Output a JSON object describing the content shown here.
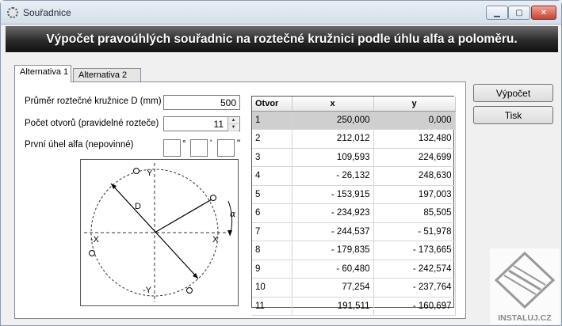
{
  "window": {
    "title": "Souřadnice",
    "minimize": "▁",
    "maximize": "▢",
    "close": "✕"
  },
  "banner": {
    "text": "Výpočet pravoúhlých souřadnic na roztečné kružnici podle úhlu alfa a poloměru."
  },
  "tabs": [
    {
      "label": "Alternativa 1",
      "active": true
    },
    {
      "label": "Alternativa 2",
      "active": false
    }
  ],
  "form": {
    "diameter_label": "Průměr roztečné kružnice D (mm)",
    "diameter_value": "500",
    "holes_label": "Počet otvorů (pravidelné rozteče)",
    "holes_value": "11",
    "angle_label": "První úhel alfa (nepovinné)",
    "deg_symbol": "°",
    "min_symbol": "'",
    "sec_symbol": "\""
  },
  "diagram": {
    "label_y_top": "Y",
    "label_y_bottom": "-Y",
    "label_x_right": "X",
    "label_x_left": "-X",
    "label_d": "D",
    "label_alpha": "α"
  },
  "table": {
    "headers": [
      "Otvor",
      "x",
      "y"
    ],
    "rows": [
      [
        "1",
        "250,000",
        "0,000"
      ],
      [
        "2",
        "212,012",
        "132,480"
      ],
      [
        "3",
        "109,593",
        "224,699"
      ],
      [
        "4",
        "- 26,132",
        "248,630"
      ],
      [
        "5",
        "- 153,915",
        "197,003"
      ],
      [
        "6",
        "- 234,923",
        "85,505"
      ],
      [
        "7",
        "- 244,537",
        "- 51,978"
      ],
      [
        "8",
        "- 179,835",
        "- 173,665"
      ],
      [
        "9",
        "- 60,480",
        "- 242,574"
      ],
      [
        "10",
        "77,254",
        "- 237,764"
      ],
      [
        "11",
        "191,511",
        "- 160,697"
      ]
    ],
    "selected_row": 0
  },
  "actions": {
    "compute_label": "Výpočet",
    "print_label": "Tisk"
  },
  "watermark": {
    "text": "INSTALUJ.CZ"
  }
}
